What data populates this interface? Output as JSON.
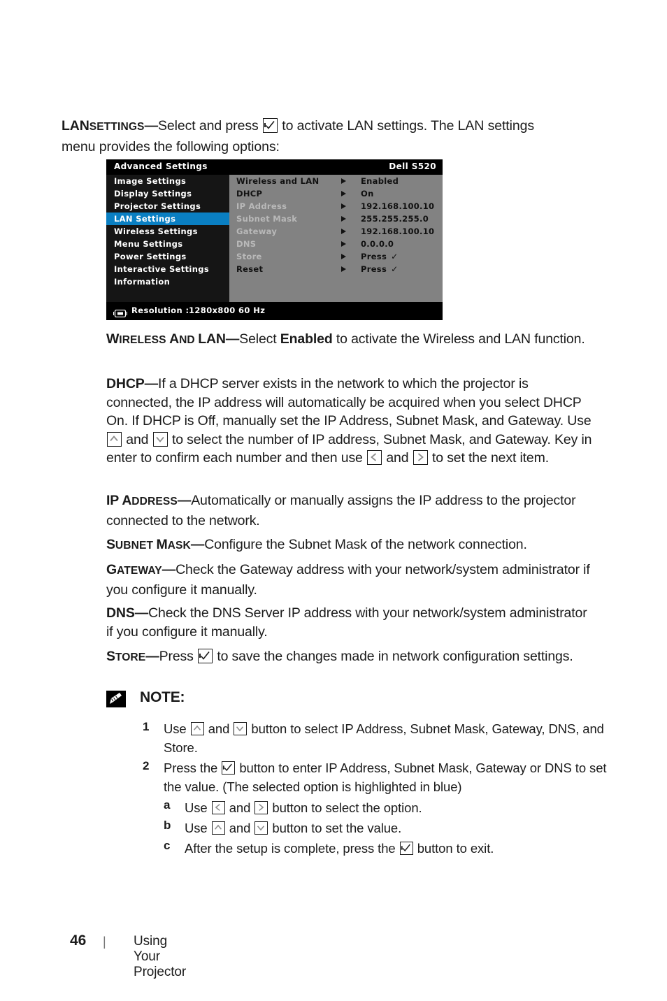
{
  "lead": {
    "term_cap": "LAN",
    "term_rest": "SETTINGS",
    "dash": "—",
    "text_before_key": "Select and press",
    "text_after_key": "to activate LAN settings. The LAN settings menu provides the following options:"
  },
  "osd": {
    "title": "Advanced Settings",
    "model": "Dell S520",
    "sidebar": [
      {
        "label": "Image Settings",
        "selected": false
      },
      {
        "label": "Display Settings",
        "selected": false
      },
      {
        "label": "Projector Settings",
        "selected": false
      },
      {
        "label": "LAN Settings",
        "selected": true
      },
      {
        "label": "Wireless Settings",
        "selected": false
      },
      {
        "label": "Menu Settings",
        "selected": false
      },
      {
        "label": "Power Settings",
        "selected": false
      },
      {
        "label": "Interactive Settings",
        "selected": false
      },
      {
        "label": "Information",
        "selected": false
      }
    ],
    "rows": [
      {
        "label": "Wireless and LAN",
        "value": "Enabled",
        "dimmed": false,
        "check": false
      },
      {
        "label": "DHCP",
        "value": "On",
        "dimmed": false,
        "check": false
      },
      {
        "label": "IP Address",
        "value": "192.168.100.10",
        "dimmed": true,
        "check": false
      },
      {
        "label": "Subnet Mask",
        "value": "255.255.255.0",
        "dimmed": true,
        "check": false
      },
      {
        "label": "Gateway",
        "value": "192.168.100.10",
        "dimmed": true,
        "check": false
      },
      {
        "label": "DNS",
        "value": "0.0.0.0",
        "dimmed": true,
        "check": false
      },
      {
        "label": "Store",
        "value": "Press",
        "dimmed": true,
        "check": true
      },
      {
        "label": "Reset",
        "value": "Press",
        "dimmed": false,
        "check": true
      }
    ],
    "footer": {
      "label": "Resolution :",
      "value": "1280x800 60 Hz"
    },
    "colors": {
      "highlight_blue": "#0a7fc2",
      "panel_gray": "#828282",
      "sidebar_black": "#151515",
      "dim_text": "#b9b9b9"
    }
  },
  "sections": [
    {
      "term_cap": "W",
      "term_rest": "IRELESS ",
      "term_cap2": "A",
      "term_rest2": "ND ",
      "term_tail": "LAN",
      "dash": "—",
      "body_1": "Select ",
      "body_bold": "Enabled",
      "body_2": " to activate the Wireless and LAN function."
    }
  ],
  "dhcp": {
    "term": "DHCP",
    "dash": "—",
    "p1": "If a DHCP server exists in the network to which the projector is connected, the IP address will automatically be acquired when you select DHCP On. If DHCP is Off, manually set the IP Address, Subnet Mask, and Gateway. Use",
    "p2": "and",
    "p3": "to select the number of IP address, Subnet Mask, and Gateway. Key in enter to confirm each number and then use",
    "p4": "and",
    "p5": "to set the next item."
  },
  "ip_address": {
    "term_cap": "IP A",
    "term_rest": "DDRESS",
    "dash": "—",
    "body": "Automatically or manually assigns the IP address to the projector connected to the network."
  },
  "subnet_mask": {
    "term_cap": "S",
    "term_rest": "UBNET ",
    "term_cap2": "M",
    "term_rest2": "ASK",
    "dash": "—",
    "body": "Configure the Subnet Mask of the network connection."
  },
  "gateway": {
    "term_cap": "G",
    "term_rest": "ATEWAY",
    "dash": "—",
    "body": "Check the Gateway address with your network/system administrator if you configure it manually."
  },
  "dns": {
    "term": "DNS",
    "dash": "—",
    "body": "Check the DNS Server IP address with your network/system administrator if you configure it manually."
  },
  "store": {
    "term_cap": "S",
    "term_rest": "TORE",
    "dash": "—",
    "body_1": "Press",
    "body_2": "to save the changes made in network configuration settings."
  },
  "note": {
    "title": "NOTE:",
    "icon": "pencil-note-icon",
    "items": [
      {
        "num": "1",
        "text_1": "Use",
        "text_2": "and",
        "text_3": "button to select IP Address, Subnet Mask, Gateway, DNS, and Store."
      },
      {
        "num": "2",
        "text_1": "Press the",
        "text_2": "button to enter IP Address, Subnet Mask, Gateway or DNS to set the value. (The selected option is highlighted in blue)"
      }
    ],
    "sub_items": [
      {
        "letter": "a",
        "text_1": "Use",
        "text_2": "and",
        "text_3": "button to select the option."
      },
      {
        "letter": "b",
        "text_1": "Use",
        "text_2": "and",
        "text_3": "button to set the value."
      },
      {
        "letter": "c",
        "text_1": "After the setup is complete, press the",
        "text_2": "button to exit."
      }
    ]
  },
  "page_footer": {
    "number": "46",
    "separator": "|",
    "title": "Using Your Projector"
  }
}
